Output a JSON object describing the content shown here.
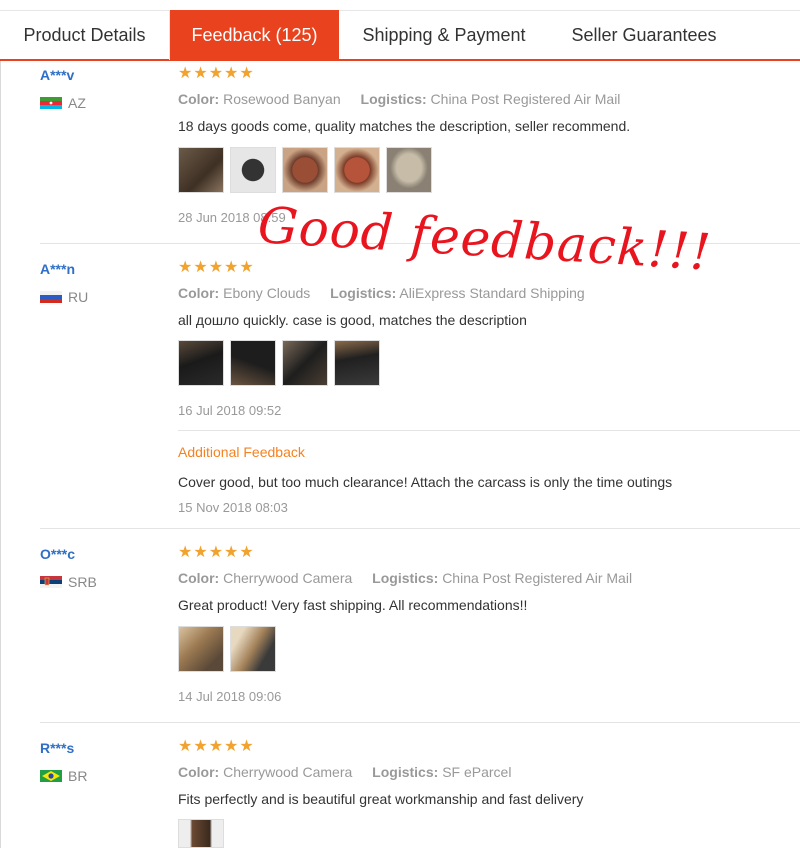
{
  "tabs": [
    {
      "label": "Product Details"
    },
    {
      "label": "Feedback (125)"
    },
    {
      "label": "Shipping & Payment"
    },
    {
      "label": "Seller Guarantees"
    }
  ],
  "stars": "★★★★★",
  "labels": {
    "color": "Color:",
    "logistics": "Logistics:",
    "additional": "Additional Feedback"
  },
  "reviews": [
    {
      "user": "A***v",
      "country": "AZ",
      "color": "Rosewood Banyan",
      "logistics": "China Post Registered Air Mail",
      "text": "18 days goods come, quality matches the description, seller recommend.",
      "date": "28 Jun 2018 08:59"
    },
    {
      "user": "A***n",
      "country": "RU",
      "color": "Ebony Clouds",
      "logistics": "AliExpress Standard Shipping",
      "text": "all дошло quickly. case is good, matches the description",
      "date": "16 Jul 2018 09:52",
      "additional_text": "Cover good, but too much clearance! Attach the carcass is only the time outings",
      "additional_date": "15 Nov 2018 08:03"
    },
    {
      "user": "O***c",
      "country": "SRB",
      "color": "Cherrywood Camera",
      "logistics": "China Post Registered Air Mail",
      "text": "Great product! Very fast shipping. All recommendations!!",
      "date": "14 Jul 2018 09:06"
    },
    {
      "user": "R***s",
      "country": "BR",
      "color": "Cherrywood Camera",
      "logistics": "SF eParcel",
      "text": "Fits perfectly and is beautiful great workmanship and fast delivery"
    }
  ],
  "overlay_text": "Good feedback!!!",
  "colors": {
    "accent": "#e8421e",
    "star": "#f2a22e",
    "link": "#2f6fc7",
    "additional": "#f58220",
    "overlay": "#e8141e"
  }
}
